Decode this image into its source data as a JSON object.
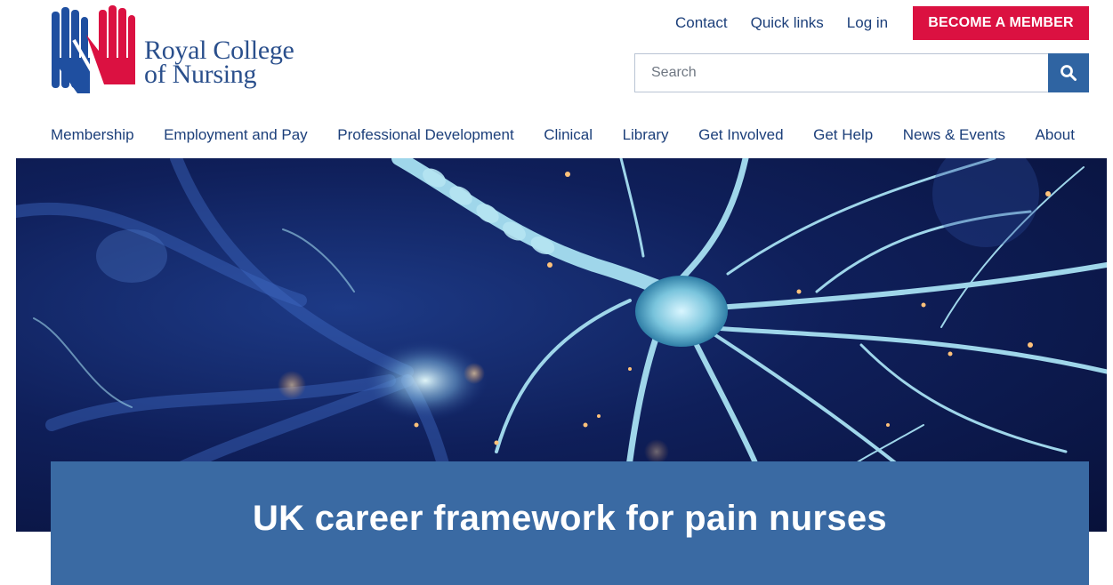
{
  "logo": {
    "line1": "Royal College",
    "line2": "of Nursing"
  },
  "utility_nav": [
    {
      "label": "Contact"
    },
    {
      "label": "Quick links"
    },
    {
      "label": "Log in"
    }
  ],
  "member_button": {
    "label": "BECOME A MEMBER"
  },
  "search": {
    "placeholder": "Search"
  },
  "main_nav": [
    {
      "label": "Membership"
    },
    {
      "label": "Employment and Pay"
    },
    {
      "label": "Professional Development"
    },
    {
      "label": "Clinical"
    },
    {
      "label": "Library"
    },
    {
      "label": "Get Involved"
    },
    {
      "label": "Get Help"
    },
    {
      "label": "News & Events"
    },
    {
      "label": "About"
    }
  ],
  "hero": {
    "title": "UK career framework for pain nurses"
  },
  "colors": {
    "brand_blue": "#2a4f8c",
    "accent_red": "#db1141",
    "title_box": "#3a6aa3",
    "search_button": "#2f64a2"
  }
}
